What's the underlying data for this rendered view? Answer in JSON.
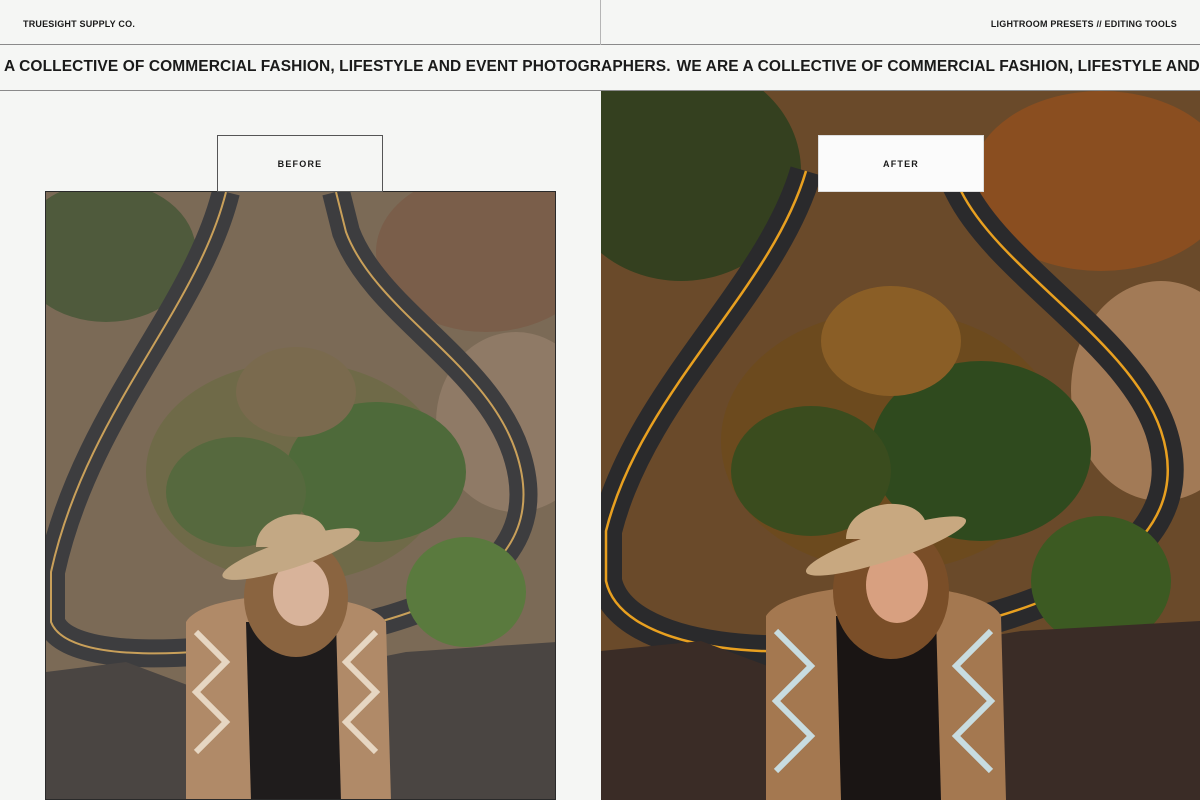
{
  "header": {
    "brand": "TRUESIGHT SUPPLY CO.",
    "tagline": "LIGHTROOM PRESETS // EDITING TOOLS"
  },
  "ticker": {
    "text_1": "A COLLECTIVE OF COMMERCIAL FASHION, LIFESTYLE AND EVENT PHOTOGRAPHERS.",
    "text_2": "WE ARE A COLLECTIVE OF COMMERCIAL FASHION, LIFESTYLE AND EVENT PHOTOGRA"
  },
  "labels": {
    "before": "BEFORE",
    "after": "AFTER"
  },
  "colors": {
    "background": "#f5f6f4",
    "road": "#3a3a3c",
    "road_line_before": "#c9a05a",
    "road_line_after": "#e8a020"
  }
}
